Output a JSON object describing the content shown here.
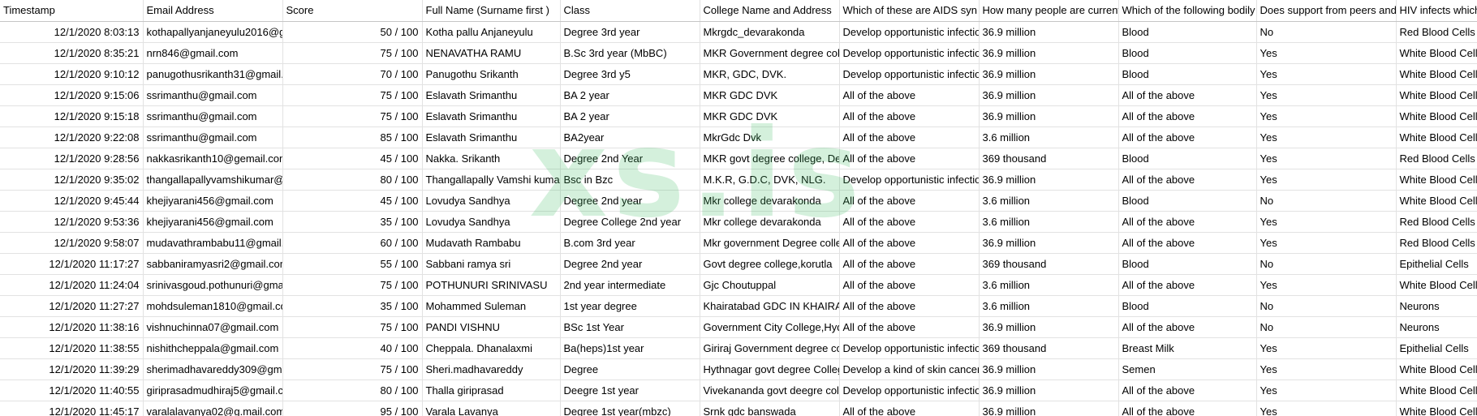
{
  "sheet": {
    "columns": [
      "Timestamp",
      "Email Address",
      "Score",
      "Full Name (Surname first )",
      "Class",
      "College Name and Address",
      "Which of these are AIDS syn",
      "How many people are current",
      "Which of the following bodily",
      "Does support from peers and",
      "HIV infects which"
    ],
    "rows": [
      [
        "12/1/2020 8:03:13",
        "kothapallyanjaneyulu2016@g",
        "50 / 100",
        "Kotha pallu Anjaneyulu",
        "Degree 3rd year",
        "Mkrgdc_devarakonda",
        "Develop opportunistic infectio",
        "36.9 million",
        "Blood",
        "No",
        "Red Blood Cells"
      ],
      [
        "12/1/2020 8:35:21",
        "nrn846@gmail.com",
        "75 / 100",
        "NENAVATHA RAMU",
        "B.Sc 3rd year (MbBC)",
        "MKR Government degree col",
        "Develop opportunistic infectio",
        "36.9 million",
        "Blood",
        "Yes",
        "White Blood Cells"
      ],
      [
        "12/1/2020 9:10:12",
        "panugothusrikanth31@gmail.",
        "70 / 100",
        "Panugothu Srikanth",
        "Degree 3rd y5",
        "MKR, GDC, DVK.",
        "Develop opportunistic infectio",
        "36.9 million",
        "Blood",
        "Yes",
        "White Blood Cells"
      ],
      [
        "12/1/2020 9:15:06",
        "ssrimanthu@gmail.com",
        "75 / 100",
        "Eslavath Srimanthu",
        "BA 2 year",
        "MKR GDC DVK",
        "All of the above",
        "36.9 million",
        "All of the above",
        "Yes",
        "White Blood Cells"
      ],
      [
        "12/1/2020 9:15:18",
        "ssrimanthu@gmail.com",
        "75 / 100",
        "Eslavath Srimanthu",
        "BA 2 year",
        "MKR GDC DVK",
        "All of the above",
        "36.9 million",
        "All of the above",
        "Yes",
        "White Blood Cells"
      ],
      [
        "12/1/2020 9:22:08",
        "ssrimanthu@gmail.com",
        "85 / 100",
        "Eslavath Srimanthu",
        "BA2year",
        "MkrGdc Dvk",
        "All of the above",
        "3.6 million",
        "All of the above",
        "Yes",
        "White Blood Cells"
      ],
      [
        "12/1/2020 9:28:56",
        "nakkasrikanth10@gemail.com",
        "45 / 100",
        "Nakka. Srikanth",
        "Degree 2nd Year",
        "MKR govt degree college, De",
        "All of the above",
        "369 thousand",
        "Blood",
        "Yes",
        "Red Blood Cells"
      ],
      [
        "12/1/2020 9:35:02",
        "thangallapallyvamshikumar@",
        "80 / 100",
        "Thangallapally Vamshi kumar",
        "Bsc in Bzc",
        "M.K.R, G.D.C, DVK, NLG.",
        "Develop opportunistic infectio",
        "36.9 million",
        "All of the above",
        "Yes",
        "White Blood Cells"
      ],
      [
        "12/1/2020 9:45:44",
        "khejiyarani456@gmail.com",
        "45 / 100",
        "Lovudya Sandhya",
        "Degree 2nd year",
        "Mkr college devarakonda",
        "All of the above",
        "3.6 million",
        "Blood",
        "No",
        "White Blood Cells"
      ],
      [
        "12/1/2020 9:53:36",
        "khejiyarani456@gmail.com",
        "35 / 100",
        "Lovudya Sandhya",
        "Degree College 2nd year",
        "Mkr college devarakonda",
        "All of the above",
        "3.6 million",
        "All of the above",
        "Yes",
        "Red Blood Cells"
      ],
      [
        "12/1/2020 9:58:07",
        "mudavathrambabu11@gmail.",
        "60 / 100",
        "Mudavath Rambabu",
        "B.com 3rd year",
        "Mkr government Degree colle",
        "All of the above",
        "36.9 million",
        "All of the above",
        "Yes",
        "Red Blood Cells"
      ],
      [
        "12/1/2020 11:17:27",
        "sabbaniramyasri2@gmail.com",
        "55 / 100",
        "Sabbani ramya sri",
        "Degree 2nd year",
        "Govt degree college,korutla",
        "All of the above",
        "369 thousand",
        "Blood",
        "No",
        "Epithelial Cells"
      ],
      [
        "12/1/2020 11:24:04",
        "srinivasgoud.pothunuri@gmai",
        "75 / 100",
        "POTHUNURI SRINIVASU",
        "2nd year intermediate",
        "Gjc Choutuppal",
        "All of the above",
        "3.6 million",
        "All of the above",
        "Yes",
        "White Blood Cells"
      ],
      [
        "12/1/2020 11:27:27",
        "mohdsuleman1810@gmail.co",
        "35 / 100",
        "Mohammed Suleman",
        "1st year degree",
        "Khairatabad GDC IN KHAIRA",
        "All of the above",
        "3.6 million",
        "Blood",
        "No",
        "Neurons"
      ],
      [
        "12/1/2020 11:38:16",
        "vishnuchinna07@gmail.com",
        "75 / 100",
        "PANDI VISHNU",
        "BSc 1st Year",
        "Government City College,Hyd",
        "All of the above",
        "36.9 million",
        "All of the above",
        "No",
        "Neurons"
      ],
      [
        "12/1/2020 11:38:55",
        "nishithcheppala@gmail.com",
        "40 / 100",
        "Cheppala. Dhanalaxmi",
        "Ba(heps)1st year",
        "Giriraj Government degree co",
        "Develop opportunistic infectio",
        "369 thousand",
        "Breast Milk",
        "Yes",
        "Epithelial Cells"
      ],
      [
        "12/1/2020 11:39:29",
        "sherimadhavareddy309@gma",
        "75 / 100",
        "Sheri.madhavareddy",
        "Degree",
        "Hythnagar govt degree Colleg",
        "Develop a kind of skin cancer",
        "36.9 million",
        "Semen",
        "Yes",
        "White Blood Cells"
      ],
      [
        "12/1/2020 11:40:55",
        "giriprasadmudhiraj5@gmail.c",
        "80 / 100",
        "Thalla giriprasad",
        "Deegre 1st year",
        "Vivekananda govt deegre coll",
        "Develop opportunistic infectio",
        "36.9 million",
        "All of the above",
        "Yes",
        "White Blood Cells"
      ],
      [
        "12/1/2020 11:45:17",
        "varalalavanya02@g.mail.com",
        "95 / 100",
        "Varala Lavanya",
        "Degree 1st year(mbzc)",
        "Srnk gdc banswada",
        "All of the above",
        "36.9 million",
        "All of the above",
        "Yes",
        "White Blood Cells"
      ]
    ]
  },
  "watermark": {
    "text": "xs.is"
  }
}
